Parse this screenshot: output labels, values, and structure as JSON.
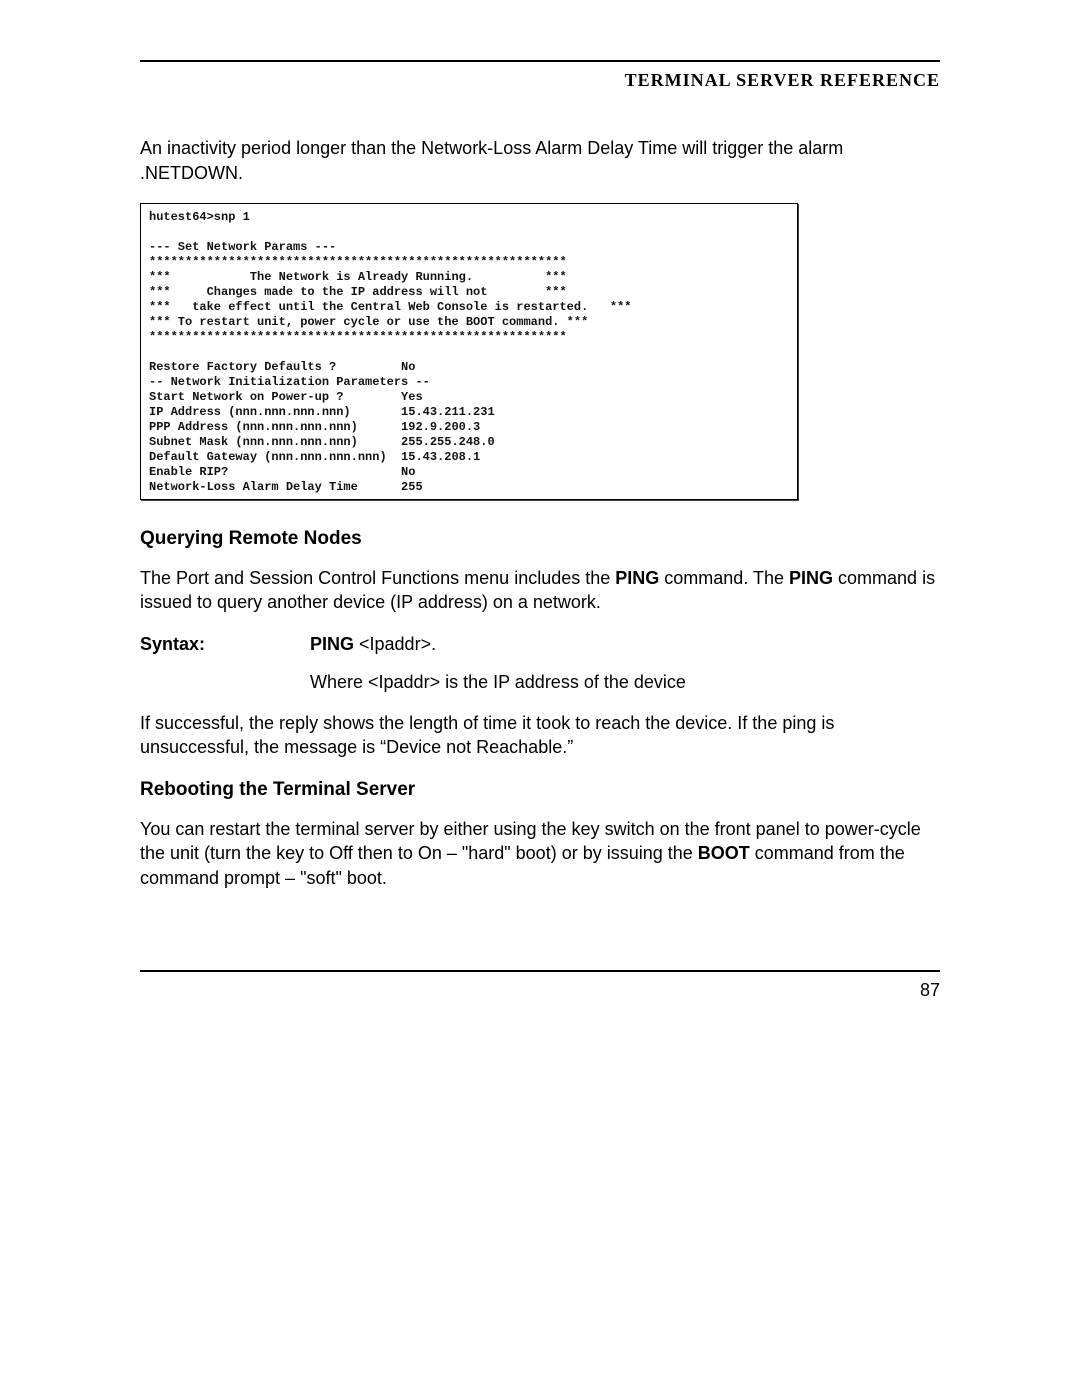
{
  "header": {
    "title": "TERMINAL SERVER REFERENCE"
  },
  "intro_para": {
    "pre": "An inactivity period longer than the Network-Loss Alarm Delay Time will trigger the alarm .NETDOWN."
  },
  "terminal": {
    "lines": "hutest64>snp 1\n\n--- Set Network Params ---\n**********************************************************\n***           The Network is Already Running.          ***\n***     Changes made to the IP address will not        ***\n***   take effect until the Central Web Console is restarted.   ***\n*** To restart unit, power cycle or use the BOOT command. ***\n**********************************************************\n\nRestore Factory Defaults ?         No\n-- Network Initialization Parameters --\nStart Network on Power-up ?        Yes\nIP Address (nnn.nnn.nnn.nnn)       15.43.211.231\nPPP Address (nnn.nnn.nnn.nnn)      192.9.200.3\nSubnet Mask (nnn.nnn.nnn.nnn)      255.255.248.0\nDefault Gateway (nnn.nnn.nnn.nnn)  15.43.208.1\nEnable RIP?                        No\nNetwork-Loss Alarm Delay Time      255"
  },
  "section1": {
    "title": "Querying Remote Nodes",
    "para_pre": "The Port and Session Control Functions menu includes the ",
    "ping1": "PING",
    "para_mid": " command. The ",
    "ping2": "PING",
    "para_post": " command is issued to query another device (IP address) on a network.",
    "syntax_label": "Syntax:",
    "syntax_cmd": "PING",
    "syntax_arg": " <Ipaddr>.",
    "syntax_note": "Where <Ipaddr> is the IP address of the device",
    "result": "If successful, the reply shows the length of time it took to reach the device.  If the ping is unsuccessful, the message is “Device not Reachable.”"
  },
  "section2": {
    "title": "Rebooting the Terminal Server",
    "pre": "You can restart the terminal server by either using the key switch on the front panel to power-cycle the unit (turn the key to Off then to On – \"hard\" boot) or by issuing the ",
    "boot": "BOOT",
    "post": " command from the command prompt – \"soft\" boot."
  },
  "footer": {
    "page": "87"
  }
}
